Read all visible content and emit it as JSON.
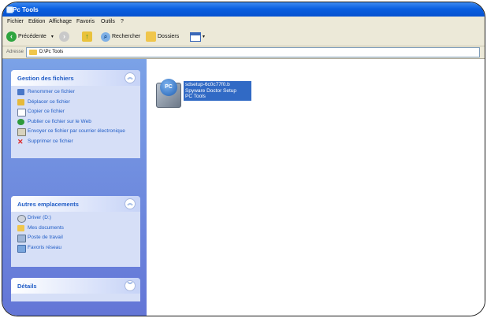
{
  "window": {
    "title": "Pc Tools"
  },
  "menu": [
    "Fichier",
    "Edition",
    "Affichage",
    "Favoris",
    "Outils",
    "?"
  ],
  "toolbar": {
    "back_label": "Précédente",
    "search_label": "Rechercher",
    "folders_label": "Dossiers"
  },
  "address": {
    "label": "Adresse",
    "path": "D:\\Pc Tools"
  },
  "panels": {
    "file_tasks": {
      "title": "Gestion des fichiers",
      "items": [
        "Renommer ce fichier",
        "Déplacer ce fichier",
        "Copier ce fichier",
        "Publier ce fichier sur le Web",
        "Envoyer ce fichier par courrier électronique",
        "Supprimer ce fichier"
      ]
    },
    "other_places": {
      "title": "Autres emplacements",
      "items": [
        "Driver (D:)",
        "Mes documents",
        "Poste de travail",
        "Favoris réseau"
      ]
    },
    "details": {
      "title": "Détails"
    }
  },
  "file": {
    "icon_text": "PC",
    "label_lines": [
      "sdsetup-6c0c77f0.b",
      "Spyware Doctor Setup",
      "PC Tools"
    ]
  },
  "colors": {
    "titlebar": "#0a5fe0",
    "sidepane": "#6f8fe0",
    "panel_title": "#215dc6",
    "selection": "#316ac5"
  }
}
